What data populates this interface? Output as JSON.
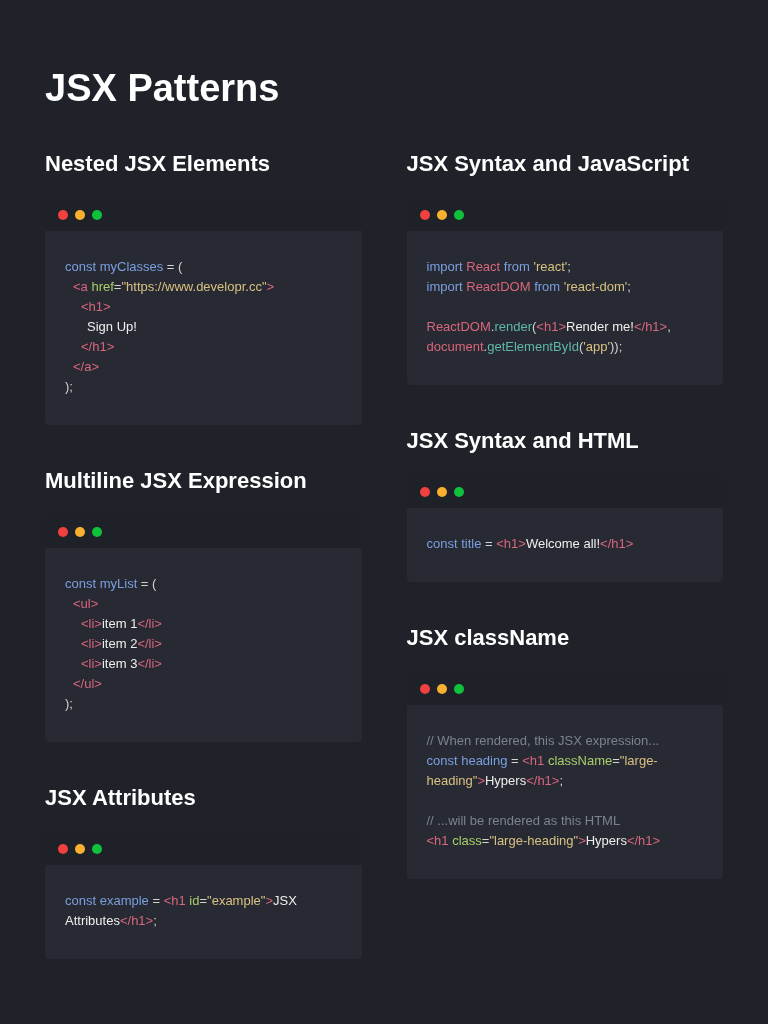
{
  "title": "JSX Patterns",
  "columns": [
    {
      "sections": [
        {
          "heading": "Nested JSX Elements",
          "paragraphs": [
            {
              "lines": [
                {
                  "tokens": [
                    {
                      "kind": "keyword",
                      "text": "const myClasses"
                    },
                    {
                      "kind": "punct",
                      "text": " = ("
                    }
                  ],
                  "children": [
                    {
                      "tokens": [
                        {
                          "kind": "tag",
                          "text": "<a "
                        },
                        {
                          "kind": "attr",
                          "text": "href"
                        },
                        {
                          "kind": "punct",
                          "text": "="
                        },
                        {
                          "kind": "string",
                          "text": "\"https://www.developr.cc\""
                        },
                        {
                          "kind": "tag",
                          "text": ">"
                        }
                      ],
                      "children": [
                        {
                          "tokens": [
                            {
                              "kind": "tag",
                              "text": "<h1>"
                            }
                          ],
                          "children": [
                            {
                              "tokens": [
                                {
                                  "kind": "text",
                                  "text": "Sign Up!"
                                }
                              ]
                            }
                          ]
                        },
                        {
                          "tokens": [
                            {
                              "kind": "tag",
                              "text": "</h1>"
                            }
                          ]
                        }
                      ]
                    },
                    {
                      "tokens": [
                        {
                          "kind": "tag",
                          "text": "</a>"
                        }
                      ]
                    }
                  ]
                },
                {
                  "tokens": [
                    {
                      "kind": "punct",
                      "text": ");"
                    }
                  ]
                }
              ]
            }
          ]
        },
        {
          "heading": "Multiline JSX Expression",
          "paragraphs": [
            {
              "lines": [
                {
                  "tokens": [
                    {
                      "kind": "keyword",
                      "text": "const myList"
                    },
                    {
                      "kind": "punct",
                      "text": " = ("
                    }
                  ],
                  "children": [
                    {
                      "tokens": [
                        {
                          "kind": "tag",
                          "text": "<ul>"
                        }
                      ],
                      "children": [
                        {
                          "tokens": [
                            {
                              "kind": "tag",
                              "text": "<li>"
                            },
                            {
                              "kind": "text",
                              "text": "item 1"
                            },
                            {
                              "kind": "tag",
                              "text": "</li>"
                            }
                          ]
                        },
                        {
                          "tokens": [
                            {
                              "kind": "tag",
                              "text": "<li>"
                            },
                            {
                              "kind": "text",
                              "text": "item 2"
                            },
                            {
                              "kind": "tag",
                              "text": "</li>"
                            }
                          ]
                        },
                        {
                          "tokens": [
                            {
                              "kind": "tag",
                              "text": "<li>"
                            },
                            {
                              "kind": "text",
                              "text": "item 3"
                            },
                            {
                              "kind": "tag",
                              "text": "</li>"
                            }
                          ]
                        }
                      ]
                    },
                    {
                      "tokens": [
                        {
                          "kind": "tag",
                          "text": "</ul>"
                        }
                      ]
                    }
                  ]
                },
                {
                  "tokens": [
                    {
                      "kind": "punct",
                      "text": ");"
                    }
                  ]
                }
              ]
            }
          ]
        },
        {
          "heading": "JSX Attributes",
          "paragraphs": [
            {
              "lines": [
                {
                  "tokens": [
                    {
                      "kind": "keyword",
                      "text": "const example"
                    },
                    {
                      "kind": "punct",
                      "text": " = "
                    },
                    {
                      "kind": "tag",
                      "text": "<h1 "
                    },
                    {
                      "kind": "attr",
                      "text": "id"
                    },
                    {
                      "kind": "punct",
                      "text": "="
                    },
                    {
                      "kind": "string",
                      "text": "\"example\""
                    },
                    {
                      "kind": "tag",
                      "text": ">"
                    },
                    {
                      "kind": "text",
                      "text": "JSX"
                    }
                  ]
                },
                {
                  "tokens": [
                    {
                      "kind": "text",
                      "text": "Attributes"
                    },
                    {
                      "kind": "tag",
                      "text": "</h1>"
                    },
                    {
                      "kind": "punct",
                      "text": ";"
                    }
                  ]
                }
              ]
            }
          ]
        }
      ]
    },
    {
      "sections": [
        {
          "heading": "JSX Syntax and JavaScript",
          "paragraphs": [
            {
              "lines": [
                {
                  "tokens": [
                    {
                      "kind": "keyword",
                      "text": "import"
                    },
                    {
                      "kind": "tag",
                      "text": " React "
                    },
                    {
                      "kind": "keyword",
                      "text": "from"
                    },
                    {
                      "kind": "string",
                      "text": " 'react'"
                    },
                    {
                      "kind": "punct",
                      "text": ";"
                    }
                  ]
                },
                {
                  "tokens": [
                    {
                      "kind": "keyword",
                      "text": "import"
                    },
                    {
                      "kind": "tag",
                      "text": " ReactDOM "
                    },
                    {
                      "kind": "keyword",
                      "text": "from"
                    },
                    {
                      "kind": "string",
                      "text": " 'react-dom'"
                    },
                    {
                      "kind": "punct",
                      "text": ";"
                    }
                  ]
                }
              ]
            },
            {
              "lines": [
                {
                  "tokens": [
                    {
                      "kind": "tag",
                      "text": "ReactDOM"
                    },
                    {
                      "kind": "punct",
                      "text": "."
                    },
                    {
                      "kind": "method",
                      "text": "render"
                    },
                    {
                      "kind": "punct",
                      "text": "("
                    },
                    {
                      "kind": "tag",
                      "text": "<h1>"
                    },
                    {
                      "kind": "text",
                      "text": "Render me!"
                    },
                    {
                      "kind": "tag",
                      "text": "</h1>"
                    },
                    {
                      "kind": "punct",
                      "text": ","
                    }
                  ]
                },
                {
                  "tokens": [
                    {
                      "kind": "tag",
                      "text": "document"
                    },
                    {
                      "kind": "punct",
                      "text": "."
                    },
                    {
                      "kind": "method",
                      "text": "getElementById"
                    },
                    {
                      "kind": "punct",
                      "text": "("
                    },
                    {
                      "kind": "string",
                      "text": "'app'"
                    },
                    {
                      "kind": "punct",
                      "text": "));"
                    }
                  ]
                }
              ]
            }
          ]
        },
        {
          "heading": "JSX Syntax and HTML",
          "paragraphs": [
            {
              "lines": [
                {
                  "tokens": [
                    {
                      "kind": "keyword",
                      "text": "const title"
                    },
                    {
                      "kind": "punct",
                      "text": " = "
                    },
                    {
                      "kind": "tag",
                      "text": "<h1>"
                    },
                    {
                      "kind": "text",
                      "text": "Welcome all!"
                    },
                    {
                      "kind": "tag",
                      "text": "</h1>"
                    }
                  ]
                }
              ]
            }
          ]
        },
        {
          "heading": "JSX className",
          "paragraphs": [
            {
              "lines": [
                {
                  "tokens": [
                    {
                      "kind": "comment",
                      "text": "// When rendered, this JSX expression..."
                    }
                  ]
                },
                {
                  "tokens": [
                    {
                      "kind": "keyword",
                      "text": "const heading"
                    },
                    {
                      "kind": "punct",
                      "text": " = "
                    },
                    {
                      "kind": "tag",
                      "text": "<h1 "
                    },
                    {
                      "kind": "attr",
                      "text": "className"
                    },
                    {
                      "kind": "punct",
                      "text": "="
                    },
                    {
                      "kind": "string",
                      "text": "\"large-"
                    }
                  ]
                },
                {
                  "tokens": [
                    {
                      "kind": "string",
                      "text": "heading\""
                    },
                    {
                      "kind": "tag",
                      "text": ">"
                    },
                    {
                      "kind": "text",
                      "text": "Hypers"
                    },
                    {
                      "kind": "tag",
                      "text": "</h1>"
                    },
                    {
                      "kind": "punct",
                      "text": ";"
                    }
                  ]
                }
              ]
            },
            {
              "lines": [
                {
                  "tokens": [
                    {
                      "kind": "comment",
                      "text": "// ...will be rendered as this HTML"
                    }
                  ]
                },
                {
                  "tokens": [
                    {
                      "kind": "tag",
                      "text": "<h1 "
                    },
                    {
                      "kind": "attr",
                      "text": "class"
                    },
                    {
                      "kind": "punct",
                      "text": "="
                    },
                    {
                      "kind": "string",
                      "text": "\"large-heading\""
                    },
                    {
                      "kind": "tag",
                      "text": ">"
                    },
                    {
                      "kind": "text",
                      "text": "Hypers"
                    },
                    {
                      "kind": "tag",
                      "text": "</h1>"
                    }
                  ]
                }
              ]
            }
          ]
        }
      ]
    }
  ]
}
